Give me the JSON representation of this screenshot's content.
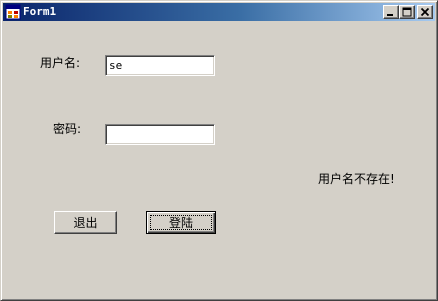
{
  "window": {
    "title": "Form1",
    "icons": {
      "app": "form-app-icon",
      "minimize": "minimize-icon",
      "maximize": "maximize-icon",
      "close": "close-icon"
    },
    "colors": {
      "face": "#d4d0c8",
      "titlebar_start": "#0a246a",
      "titlebar_end": "#a6caf0"
    }
  },
  "form": {
    "username_label": "用户名:",
    "username_value": "se",
    "password_label": "密码:",
    "password_value": "",
    "status_message": "用户名不存在!",
    "exit_button": "退出",
    "login_button": "登陆"
  }
}
